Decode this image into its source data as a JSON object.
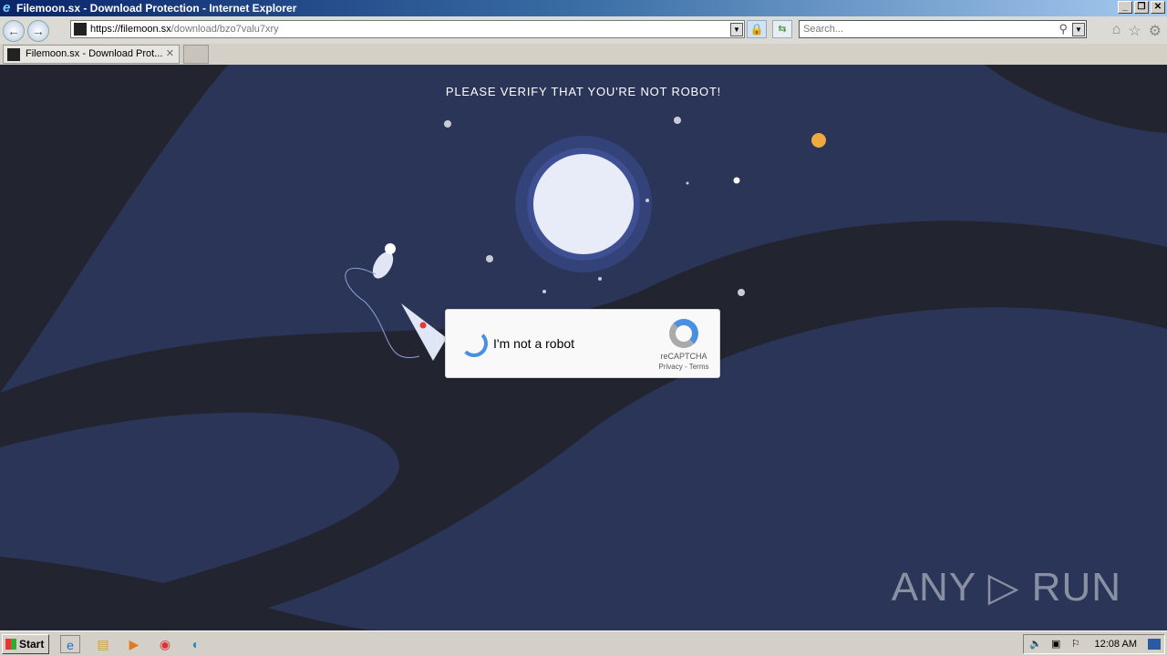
{
  "window": {
    "title": "Filemoon.sx - Download Protection - Internet Explorer"
  },
  "address": {
    "scheme_host": "https://filemoon.sx",
    "path": "/download/bzo7valu7xry"
  },
  "search": {
    "placeholder": "Search..."
  },
  "tabs": [
    {
      "label": "Filemoon.sx - Download Prot..."
    }
  ],
  "page": {
    "heading": "PLEASE VERIFY THAT YOU'RE NOT ROBOT!",
    "captcha": {
      "label": "I'm not a robot",
      "brand": "reCAPTCHA",
      "privacy": "Privacy",
      "separator": " - ",
      "terms": "Terms"
    },
    "watermark": "ANY ▷ RUN"
  },
  "taskbar": {
    "start": "Start",
    "clock": "12:08 AM"
  },
  "colors": {
    "background": "#2a3558",
    "dark_wave": "#22242f",
    "moon": "#e8ecf8",
    "planet": "#f0a840",
    "accent": "#4a90e2"
  }
}
